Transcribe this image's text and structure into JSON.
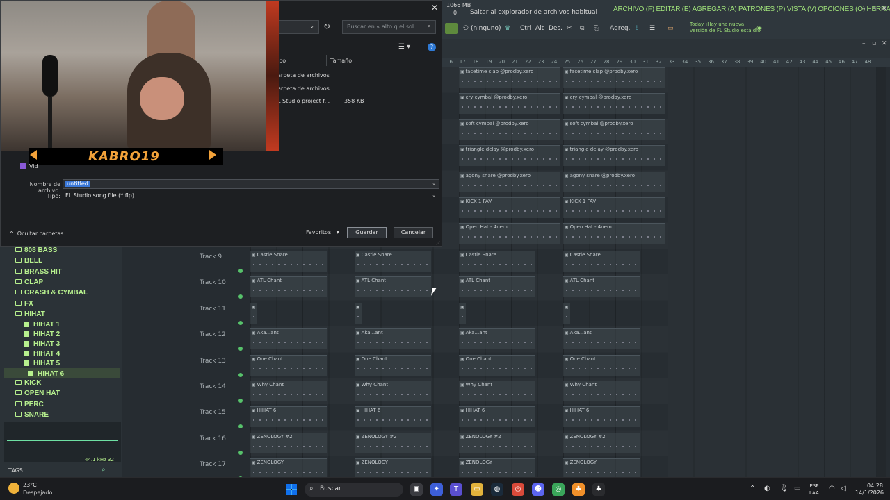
{
  "fl": {
    "mem": "1066 MB",
    "mem2": "0",
    "hint": "Saltar al explorador de archivos habitual",
    "menu": "ARCHIVO (F) EDITAR (E) AGREGAR (A) PATRONES (P) VISTA (V) OPCIONES (O) HERRAMIENTAS (T) AYUDA",
    "toolbar": {
      "pattern": "(ninguno)",
      "ctrl": "Ctrl",
      "alt": "Alt",
      "des": "Des.",
      "agreg": "Agreg."
    },
    "news_line1": "Today ¡Hay una nueva",
    "news_line2": "versión de FL Studio está di..."
  },
  "ruler": [
    "16",
    "17",
    "18",
    "19",
    "20",
    "21",
    "22",
    "23",
    "24",
    "25",
    "26",
    "27",
    "28",
    "29",
    "30",
    "31",
    "32",
    "33",
    "34",
    "35",
    "36",
    "37",
    "38",
    "39",
    "40",
    "41",
    "42",
    "43",
    "44",
    "45",
    "46",
    "47",
    "48"
  ],
  "tracks": [
    {
      "label": "Track 9",
      "clip": "Castle Snare"
    },
    {
      "label": "Track 10",
      "clip": "ATL Chant"
    },
    {
      "label": "Track 11",
      "clip": ""
    },
    {
      "label": "Track 12",
      "clip": "Aka...ant"
    },
    {
      "label": "Track 13",
      "clip": "One Chant"
    },
    {
      "label": "Track 14",
      "clip": "Why Chant"
    },
    {
      "label": "Track 15",
      "clip": "HIHAT 6"
    },
    {
      "label": "Track 16",
      "clip": "ZENOLOGY #2"
    },
    {
      "label": "Track 17",
      "clip": "ZENOLOGY"
    }
  ],
  "upper_clips": [
    "facetime clap @prodby.xero",
    "cry cymbal @prodby.xero",
    "soft cymbal @prodby.xero",
    "triangle delay @prodby.xero",
    "agony snare @prodby.xero",
    "KICK 1 FAV",
    "Open Hat - 4nem"
  ],
  "browser": {
    "items": [
      {
        "label": "808 BASS",
        "kind": "folder"
      },
      {
        "label": "BELL",
        "kind": "folder"
      },
      {
        "label": "BRASS HIT",
        "kind": "folder"
      },
      {
        "label": "CLAP",
        "kind": "folder"
      },
      {
        "label": "CRASH & CYMBAL",
        "kind": "folder"
      },
      {
        "label": "FX",
        "kind": "folder"
      },
      {
        "label": "HIHAT",
        "kind": "folder"
      },
      {
        "label": "HIHAT 1",
        "kind": "pattern"
      },
      {
        "label": "HIHAT 2",
        "kind": "pattern"
      },
      {
        "label": "HIHAT 3",
        "kind": "pattern"
      },
      {
        "label": "HIHAT 4",
        "kind": "pattern"
      },
      {
        "label": "HIHAT 5",
        "kind": "pattern"
      },
      {
        "label": "HIHAT 6",
        "kind": "pattern"
      },
      {
        "label": "KICK",
        "kind": "folder"
      },
      {
        "label": "OPEN HAT",
        "kind": "folder"
      },
      {
        "label": "PERC",
        "kind": "folder"
      },
      {
        "label": "SNARE",
        "kind": "folder"
      }
    ],
    "sample_rate": "44.1 kHz 32",
    "tags": "TAGS"
  },
  "dialog": {
    "search_placeholder": "Buscar en « alto q el sol",
    "columns": [
      "ipo",
      "Tamaño"
    ],
    "rows": [
      {
        "type": "arpeta de archivos",
        "size": ""
      },
      {
        "type": "arpeta de archivos",
        "size": ""
      },
      {
        "type": "L Studio project f...",
        "size": "358 KB"
      }
    ],
    "webcam_name": "KABRO19",
    "vid_label": "Vid",
    "filename_label": "Nombre de archivo:",
    "filename_value": "untitled",
    "type_label": "Tipo:",
    "type_value": "FL Studio song file (*.flp)",
    "hide_folders": "Ocultar carpetas",
    "favorites": "Favoritos",
    "save": "Guardar",
    "cancel": "Cancelar"
  },
  "taskbar": {
    "temp": "23°C",
    "condition": "Despejado",
    "search": "Buscar",
    "lang1": "ESP",
    "lang2": "LAA",
    "time": "04:28",
    "date": "14/1/2026"
  },
  "colors": {
    "accent_green": "#b7f08e",
    "selection_blue": "#3b78d8",
    "fl_bg": "#262c31"
  }
}
